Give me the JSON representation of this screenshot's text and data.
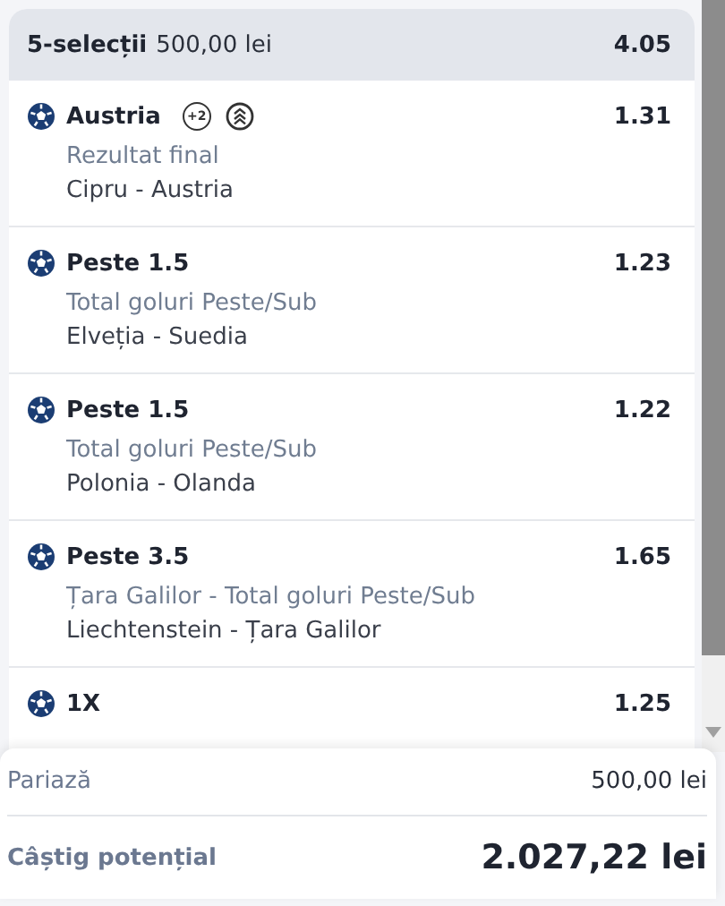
{
  "slip": {
    "title": "5-selecții",
    "stake": "500,00 lei",
    "total_odds": "4.05"
  },
  "selections": [
    {
      "pick": "Austria",
      "badge": "+2",
      "boost": true,
      "market": "Rezultat final",
      "event": "Cipru - Austria",
      "odds": "1.31"
    },
    {
      "pick": "Peste 1.5",
      "boost": false,
      "market": "Total goluri Peste/Sub",
      "event": "Elveția - Suedia",
      "odds": "1.23"
    },
    {
      "pick": "Peste 1.5",
      "boost": false,
      "market": "Total goluri Peste/Sub",
      "event": "Polonia - Olanda",
      "odds": "1.22"
    },
    {
      "pick": "Peste 3.5",
      "boost": false,
      "market": "Țara Galilor - Total goluri Peste/Sub",
      "event": "Liechtenstein - Țara Galilor",
      "odds": "1.65"
    },
    {
      "pick": "1X",
      "boost": false,
      "odds": "1.25"
    }
  ],
  "summary": {
    "stake_label": "Pariază",
    "stake_value": "500,00 lei",
    "win_label": "Câștig potențial",
    "win_value": "2.027,22 lei"
  }
}
